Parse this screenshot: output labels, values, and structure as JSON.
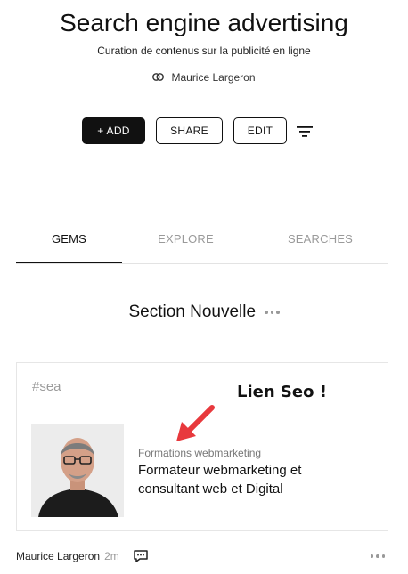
{
  "header": {
    "title": "Search engine advertising",
    "subtitle": "Curation de contenus sur la publicité en ligne",
    "author": "Maurice Largeron"
  },
  "toolbar": {
    "add_label": "+ ADD",
    "share_label": "SHARE",
    "edit_label": "EDIT"
  },
  "tabs": [
    {
      "label": "GEMS",
      "active": true
    },
    {
      "label": "EXPLORE",
      "active": false
    },
    {
      "label": "SEARCHES",
      "active": false
    }
  ],
  "section": {
    "title": "Section Nouvelle"
  },
  "card": {
    "tag": "#sea",
    "overlay_text": "Lien Seo !",
    "source": "Formations webmarketing",
    "headline": "Formateur webmarketing et consultant web et Digital",
    "arrow_color": "#e8393d"
  },
  "footer": {
    "author": "Maurice Largeron",
    "time": "2m"
  }
}
